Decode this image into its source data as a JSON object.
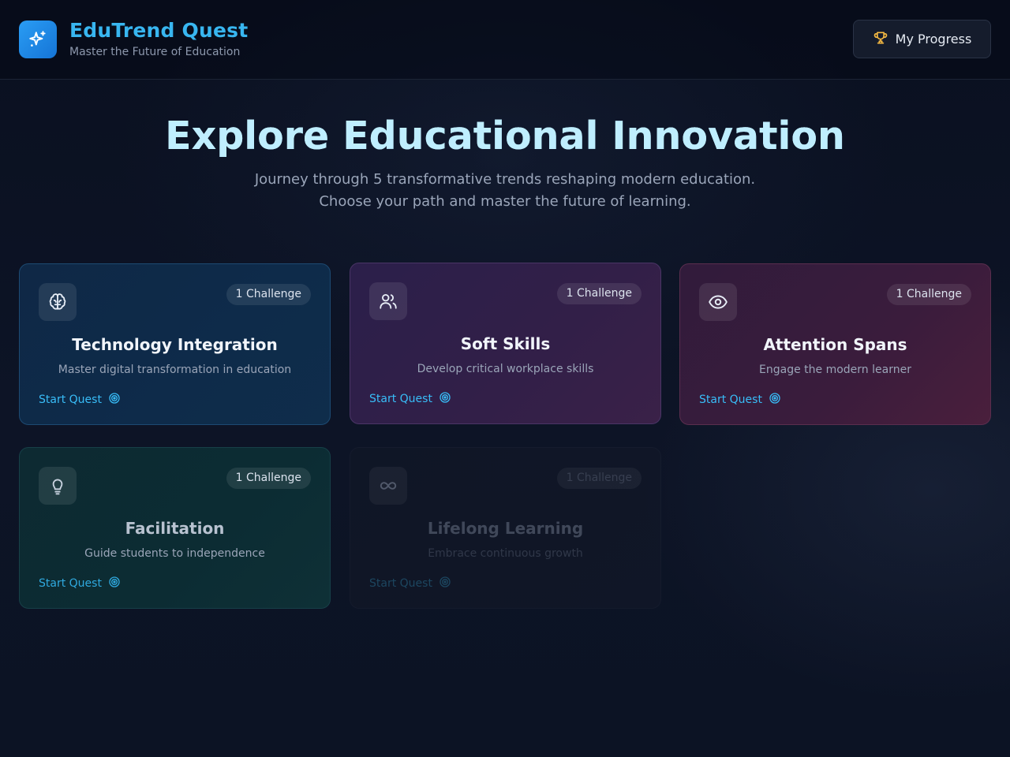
{
  "header": {
    "brand_title": "EduTrend Quest",
    "brand_subtitle": "Master the Future of Education",
    "progress_button": "My Progress"
  },
  "hero": {
    "title": "Explore Educational Innovation",
    "subtitle_line1": "Journey through 5 transformative trends reshaping modern education.",
    "subtitle_line2": "Choose your path and master the future of learning."
  },
  "colors": {
    "accent": "#38bdf8",
    "logo": "#1e88e5",
    "trophy": "#f5b942"
  },
  "cards": [
    {
      "icon": "brain-icon",
      "badge": "1 Challenge",
      "title": "Technology Integration",
      "description": "Master digital transformation in education",
      "action": "Start Quest",
      "theme": "blue"
    },
    {
      "icon": "users-icon",
      "badge": "1 Challenge",
      "title": "Soft Skills",
      "description": "Develop critical workplace skills",
      "action": "Start Quest",
      "theme": "purple"
    },
    {
      "icon": "eye-icon",
      "badge": "1 Challenge",
      "title": "Attention Spans",
      "description": "Engage the modern learner",
      "action": "Start Quest",
      "theme": "rose"
    },
    {
      "icon": "lightbulb-icon",
      "badge": "1 Challenge",
      "title": "Facilitation",
      "description": "Guide students to independence",
      "action": "Start Quest",
      "theme": "teal"
    },
    {
      "icon": "infinity-icon",
      "badge": "1 Challenge",
      "title": "Lifelong Learning",
      "description": "Embrace continuous growth",
      "action": "Start Quest",
      "theme": "faded"
    }
  ]
}
